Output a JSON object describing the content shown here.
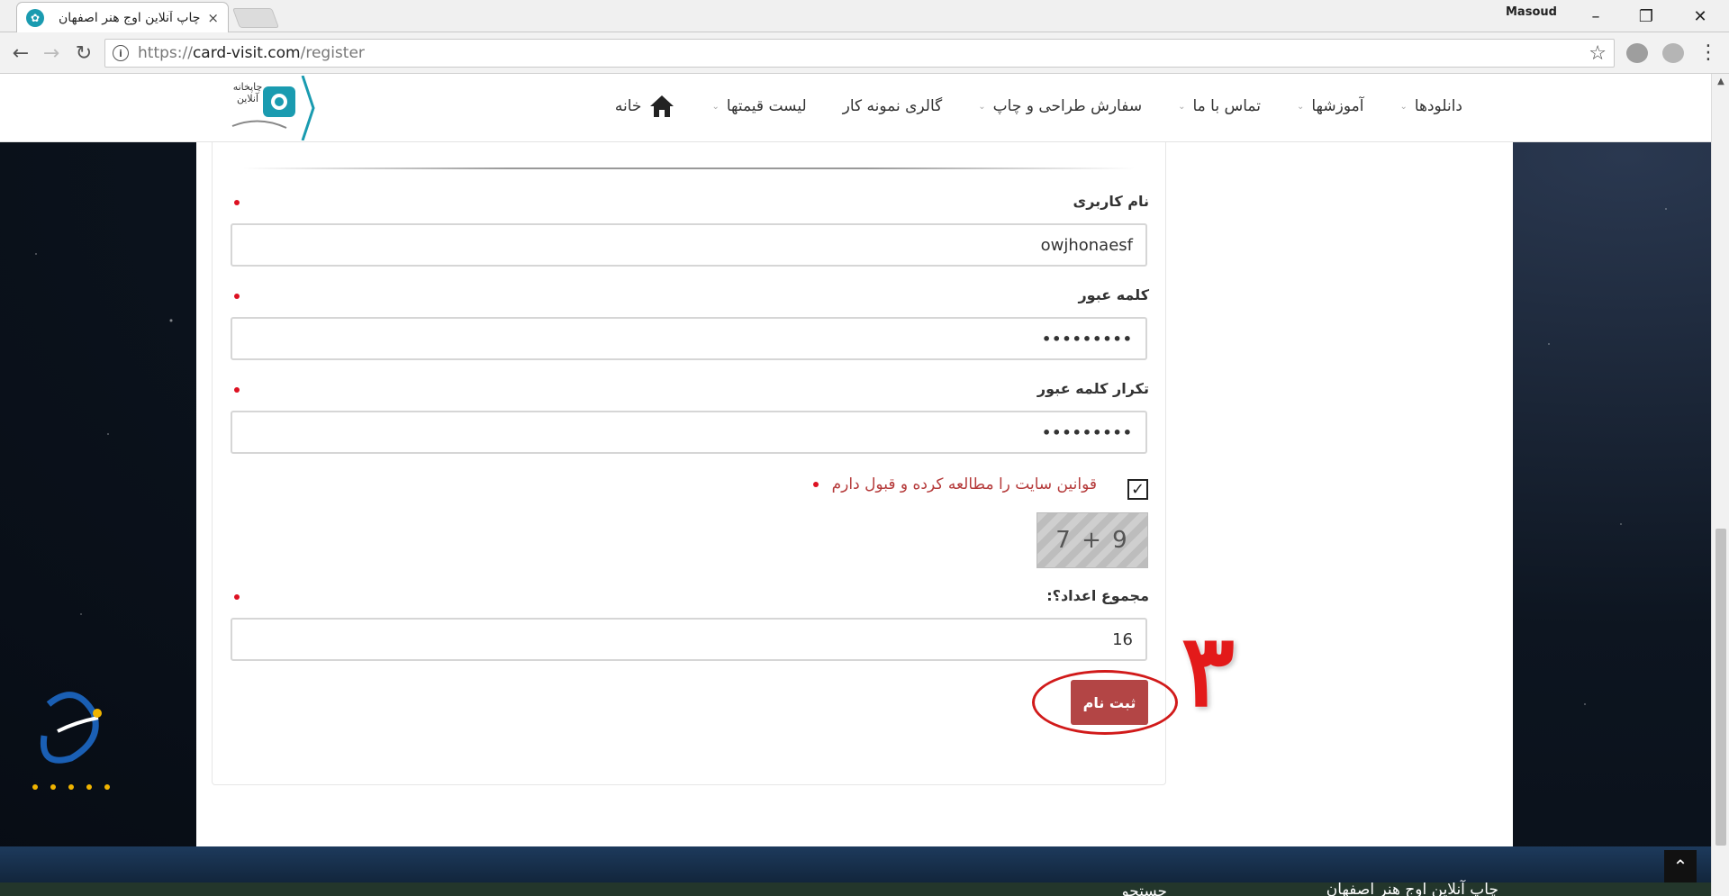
{
  "browser": {
    "tab_title": "چاپ آنلاین اوج هنر اصفهان",
    "tab_close": "×",
    "profile_name": "Masoud",
    "url_prefix": "https://",
    "url_host": "card-visit.com",
    "url_path": "/register",
    "window_buttons": {
      "minimize": "–",
      "restore": "❐",
      "close": "✕"
    },
    "nav": {
      "back": "←",
      "forward": "→",
      "reload": "↻"
    },
    "icons": {
      "info": "i",
      "star": "☆",
      "menu": "⋮"
    }
  },
  "site": {
    "logo_text": "چاپخانه آنلاین",
    "nav_items": [
      {
        "label": "خانه",
        "icon": "home-icon",
        "caret": false
      },
      {
        "label": "لیست قیمتها",
        "caret": true
      },
      {
        "label": "گالری نمونه کار",
        "caret": false
      },
      {
        "label": "سفارش طراحی و چاپ",
        "caret": true
      },
      {
        "label": "تماس با ما",
        "caret": true
      },
      {
        "label": "آموزشها",
        "caret": true
      },
      {
        "label": "دانلودها",
        "caret": true
      }
    ],
    "caret_glyph": "⌄"
  },
  "form": {
    "username": {
      "label": "نام کاربری",
      "value": "owjhonaesf"
    },
    "password": {
      "label": "کلمه عبور",
      "value": "•••••••••"
    },
    "password_confirm": {
      "label": "تکرار کلمه عبور",
      "value": "•••••••••"
    },
    "terms": {
      "label": "قوانین سایت را مطالعه کرده و قبول دارم",
      "checked": true,
      "check_glyph": "✓"
    },
    "captcha": {
      "question": "7 + 9"
    },
    "sum": {
      "label": "مجموع اعداد؟:",
      "value": "16"
    },
    "submit_label": "ثبت نام"
  },
  "annotation": {
    "step_number": "۳",
    "color": "#e31a1a"
  },
  "footer": {
    "title": "چاپ آنلاین اوج هنر اصفهان",
    "search_label": "جستجو",
    "back_to_top": "⌃"
  },
  "colors": {
    "accent_button": "#b34545",
    "required_dot": "#dd1122",
    "terms_text": "#b53a3a"
  }
}
